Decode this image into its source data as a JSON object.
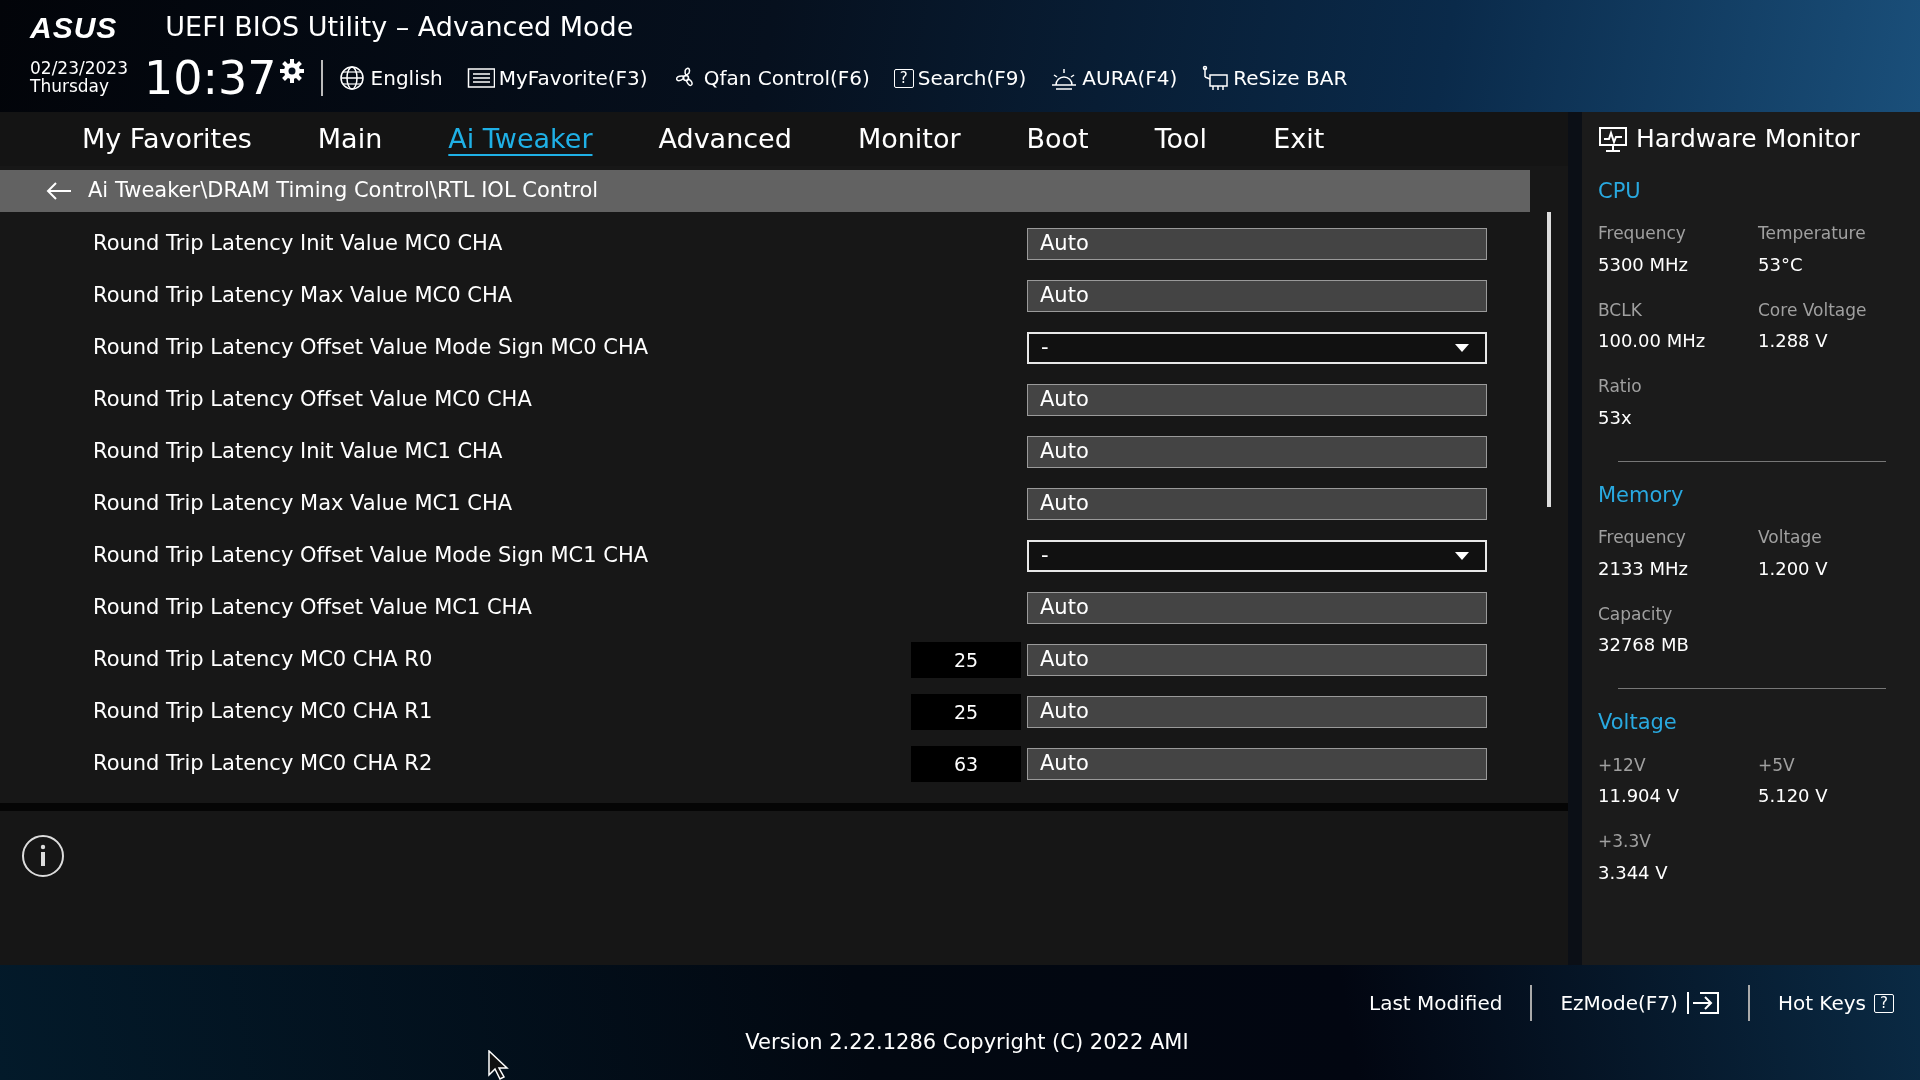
{
  "header": {
    "logo": "ASUS",
    "title": "UEFI BIOS Utility – Advanced Mode",
    "date": "02/23/2023",
    "day": "Thursday",
    "time": "10:37",
    "toolbar": [
      {
        "label": "English"
      },
      {
        "label": "MyFavorite(F3)"
      },
      {
        "label": "Qfan Control(F6)"
      },
      {
        "label": "Search(F9)",
        "icon_text": "?"
      },
      {
        "label": "AURA(F4)"
      },
      {
        "label": "ReSize BAR"
      }
    ]
  },
  "tabs": [
    {
      "label": "My Favorites",
      "selected": false
    },
    {
      "label": "Main",
      "selected": false
    },
    {
      "label": "Ai Tweaker",
      "selected": true
    },
    {
      "label": "Advanced",
      "selected": false
    },
    {
      "label": "Monitor",
      "selected": false
    },
    {
      "label": "Boot",
      "selected": false
    },
    {
      "label": "Tool",
      "selected": false
    },
    {
      "label": "Exit",
      "selected": false
    }
  ],
  "breadcrumb": "Ai Tweaker\\DRAM Timing Control\\RTL IOL Control",
  "settings": [
    {
      "label": "Round Trip Latency Init Value MC0 CHA",
      "kind": "field",
      "value": "Auto"
    },
    {
      "label": "Round Trip Latency Max Value MC0 CHA",
      "kind": "field",
      "value": "Auto"
    },
    {
      "label": "Round Trip Latency Offset Value Mode Sign MC0 CHA",
      "kind": "dropdown",
      "value": "-"
    },
    {
      "label": "Round Trip Latency Offset Value MC0 CHA",
      "kind": "field",
      "value": "Auto"
    },
    {
      "label": "Round Trip Latency Init Value MC1 CHA",
      "kind": "field",
      "value": "Auto"
    },
    {
      "label": "Round Trip Latency Max Value MC1 CHA",
      "kind": "field",
      "value": "Auto"
    },
    {
      "label": "Round Trip Latency Offset Value Mode Sign MC1 CHA",
      "kind": "dropdown",
      "value": "-"
    },
    {
      "label": "Round Trip Latency Offset Value MC1 CHA",
      "kind": "field",
      "value": "Auto"
    },
    {
      "label": "Round Trip Latency MC0 CHA R0",
      "kind": "field",
      "value": "Auto",
      "reading": "25"
    },
    {
      "label": "Round Trip Latency MC0 CHA R1",
      "kind": "field",
      "value": "Auto",
      "reading": "25"
    },
    {
      "label": "Round Trip Latency MC0 CHA R2",
      "kind": "field",
      "value": "Auto",
      "reading": "63"
    }
  ],
  "hardware_monitor": {
    "title": "Hardware Monitor",
    "sections": [
      {
        "title": "CPU",
        "items": [
          {
            "label": "Frequency",
            "value": "5300 MHz"
          },
          {
            "label": "Temperature",
            "value": "53°C"
          },
          {
            "label": "BCLK",
            "value": "100.00 MHz"
          },
          {
            "label": "Core Voltage",
            "value": "1.288 V"
          },
          {
            "label": "Ratio",
            "value": "53x"
          }
        ]
      },
      {
        "title": "Memory",
        "items": [
          {
            "label": "Frequency",
            "value": "2133 MHz"
          },
          {
            "label": "Voltage",
            "value": "1.200 V"
          },
          {
            "label": "Capacity",
            "value": "32768 MB"
          }
        ]
      },
      {
        "title": "Voltage",
        "items": [
          {
            "label": "+12V",
            "value": "11.904 V"
          },
          {
            "label": "+5V",
            "value": "5.120 V"
          },
          {
            "label": "+3.3V",
            "value": "3.344 V"
          }
        ]
      }
    ]
  },
  "footer": {
    "buttons": [
      {
        "label": "Last Modified",
        "kind": "text"
      },
      {
        "label": "EzMode(F7)",
        "kind": "exit"
      },
      {
        "label": "Hot Keys",
        "kind": "key",
        "icon_text": "?"
      }
    ],
    "version": "Version 2.22.1286 Copyright (C) 2022 AMI"
  }
}
